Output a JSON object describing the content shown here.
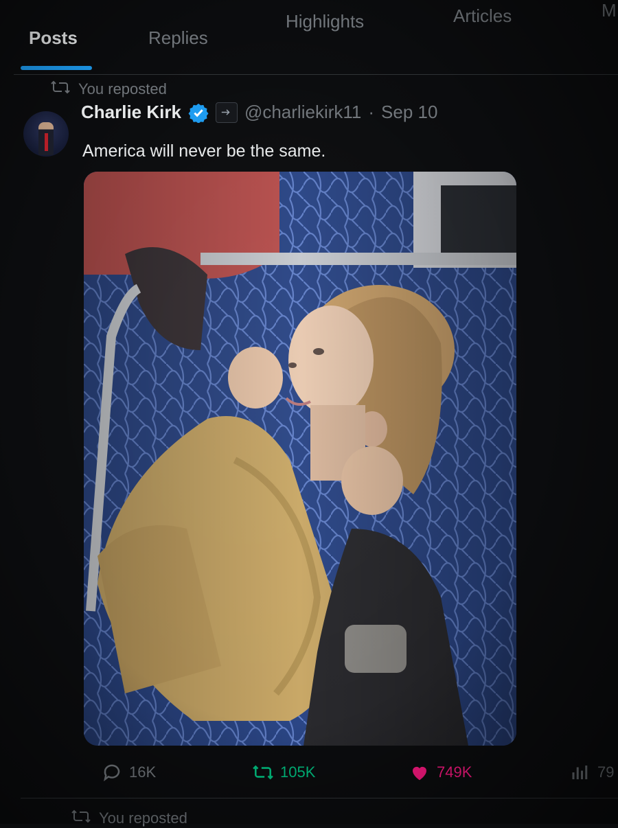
{
  "tabs": [
    {
      "label": "Posts",
      "active": true
    },
    {
      "label": "Replies",
      "active": false
    },
    {
      "label": "Highlights",
      "active": false
    },
    {
      "label": "Articles",
      "active": false
    },
    {
      "label": "M",
      "active": false
    }
  ],
  "post": {
    "repost_label": "You reposted",
    "author_name": "Charlie Kirk",
    "handle": "@charliekirk11",
    "separator": "·",
    "date": "Sep 10",
    "text": "America will never be the same.",
    "actions": {
      "replies": "16K",
      "reposts": "105K",
      "likes": "749K",
      "views": "79"
    }
  },
  "next_post": {
    "repost_label": "You reposted"
  },
  "colors": {
    "accent": "#1d9bf0",
    "muted": "#71767b",
    "repost_green": "#00ba7c",
    "like_red": "#f91880"
  }
}
